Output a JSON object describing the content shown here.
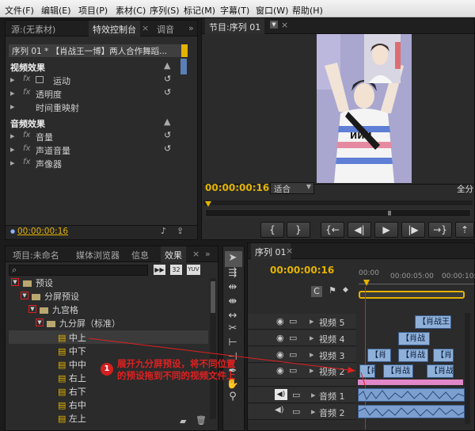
{
  "menu": [
    "文件(F)",
    "编辑(E)",
    "项目(P)",
    "素材(C)",
    "序列(S)",
    "标记(M)",
    "字幕(T)",
    "窗口(W)",
    "帮助(H)"
  ],
  "effect_controls": {
    "tabs": [
      "源:(无素材)",
      "特效控制台",
      "调音"
    ],
    "clip_label": "序列 01 * 【肖战王一博】两人合作舞蹈...",
    "video_section": "视频效果",
    "video_items": [
      "运动",
      "透明度",
      "时间重映射"
    ],
    "audio_section": "音频效果",
    "audio_items": [
      "音量",
      "声道音量",
      "声像器"
    ],
    "timecode": "00:00:00:16"
  },
  "program": {
    "tab": "节目:序列 01",
    "timecode": "00:00:00:16",
    "fit": "适合",
    "full": "全分"
  },
  "project": {
    "tabs": [
      "项目:未命名",
      "媒体浏览器",
      "信息",
      "效果"
    ],
    "tree": [
      {
        "label": "预设",
        "level": 0
      },
      {
        "label": "分屏预设",
        "level": 1
      },
      {
        "label": "九宫格",
        "level": 2
      },
      {
        "label": "九分屏（标准）",
        "level": 3
      }
    ],
    "presets": [
      "中上",
      "中下",
      "中中",
      "右上",
      "右下",
      "右中",
      "左上"
    ],
    "count1": "32",
    "count2": "YUV"
  },
  "timeline": {
    "tab": "序列 01",
    "timecode": "00:00:00:16",
    "ruler": [
      "00:00",
      "00:00:05:00",
      "00:00:10:00"
    ],
    "tracks": [
      "视频 5",
      "视频 4",
      "视频 3",
      "视频 2",
      "视频 1",
      "音频 1",
      "音频 2"
    ],
    "clip_text": "【肖战王",
    "clip_text_short": "【肖战",
    "clip_text_one": "【肖"
  },
  "annotation": {
    "number": "1",
    "line1": "展开九分屏预设，将不同位置",
    "line2": "的预设拖到不同的视频文件上"
  },
  "colors": {
    "timecode": "#e3b300",
    "annotation": "#e02020",
    "clip": "#8fb0d8"
  }
}
